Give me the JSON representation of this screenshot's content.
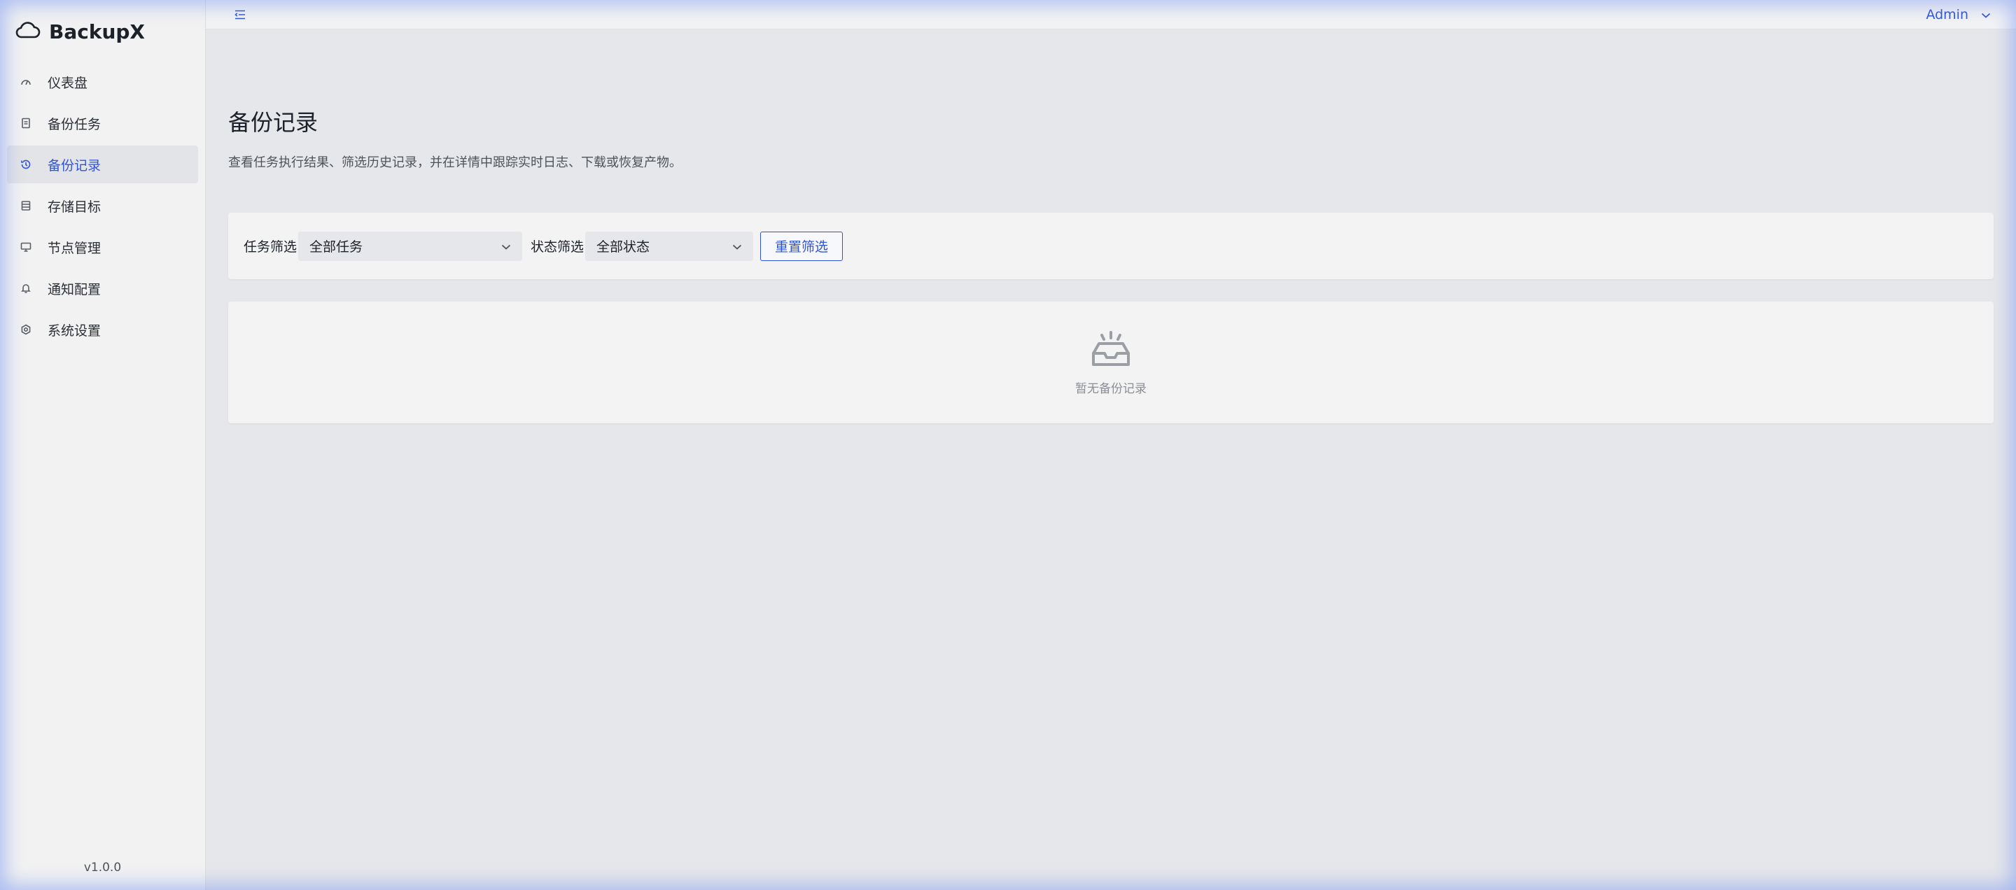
{
  "brand": {
    "name": "BackupX",
    "icon": "cloud-icon"
  },
  "sidebar": {
    "items": [
      {
        "label": "仪表盘",
        "icon": "dashboard-icon",
        "active": false
      },
      {
        "label": "备份任务",
        "icon": "file-icon",
        "active": false
      },
      {
        "label": "备份记录",
        "icon": "history-icon",
        "active": true
      },
      {
        "label": "存储目标",
        "icon": "storage-icon",
        "active": false
      },
      {
        "label": "节点管理",
        "icon": "desktop-icon",
        "active": false
      },
      {
        "label": "通知配置",
        "icon": "bell-icon",
        "active": false
      },
      {
        "label": "系统设置",
        "icon": "settings-icon",
        "active": false
      }
    ],
    "version": "v1.0.0"
  },
  "topbar": {
    "collapse_icon": "menu-fold-icon",
    "user": "Admin"
  },
  "page": {
    "title": "备份记录",
    "description": "查看任务执行结果、筛选历史记录，并在详情中跟踪实时日志、下载或恢复产物。"
  },
  "filters": {
    "task_label": "任务筛选",
    "task_value": "全部任务",
    "status_label": "状态筛选",
    "status_value": "全部状态",
    "reset_label": "重置筛选"
  },
  "empty": {
    "icon": "inbox-icon",
    "text": "暂无备份记录"
  },
  "colors": {
    "accent": "#2f54d8",
    "sidebar_bg": "#f2f2f2",
    "content_bg": "#e6e7ea"
  }
}
